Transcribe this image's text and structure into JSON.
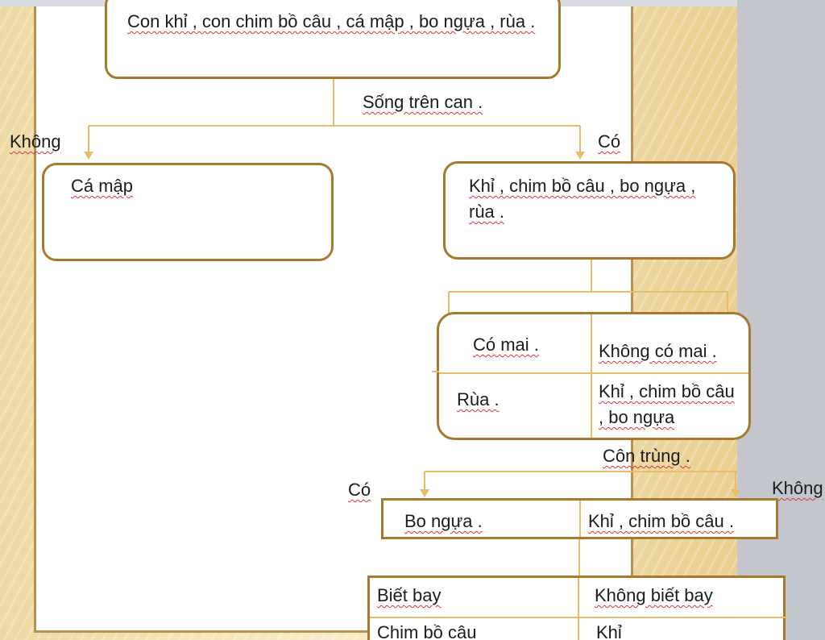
{
  "root": {
    "text": "Con khỉ , con chim bồ câu , cá mập , bo ngựa , rùa ."
  },
  "q1": {
    "question": "Sống trên can .",
    "no_label": "Không",
    "yes_label": "Có"
  },
  "left_box": {
    "text": "Cá mập"
  },
  "right_box": {
    "text": "Khỉ , chim bồ câu , bo ngựa , rùa ."
  },
  "q2_table": {
    "yes_header": "Có mai .",
    "no_header": "Không có mai .",
    "yes_value": "Rùa .",
    "no_value": "Khỉ , chim bồ câu , bo ngựa"
  },
  "q3": {
    "question": "Côn trùng .",
    "yes_label": "Có",
    "no_label": "Không"
  },
  "q3_table": {
    "yes_value": "Bo ngựa .",
    "no_value": "Khỉ , chim bồ câu ."
  },
  "q4_table": {
    "yes_header": "Biết bay",
    "no_header": "Không biết bay",
    "yes_value": "Chim bồ câu",
    "no_value": "Khỉ"
  },
  "colors": {
    "connector": "#e9bc6a",
    "box_border": "#a8782f",
    "spellcheck": "#e0303b"
  }
}
